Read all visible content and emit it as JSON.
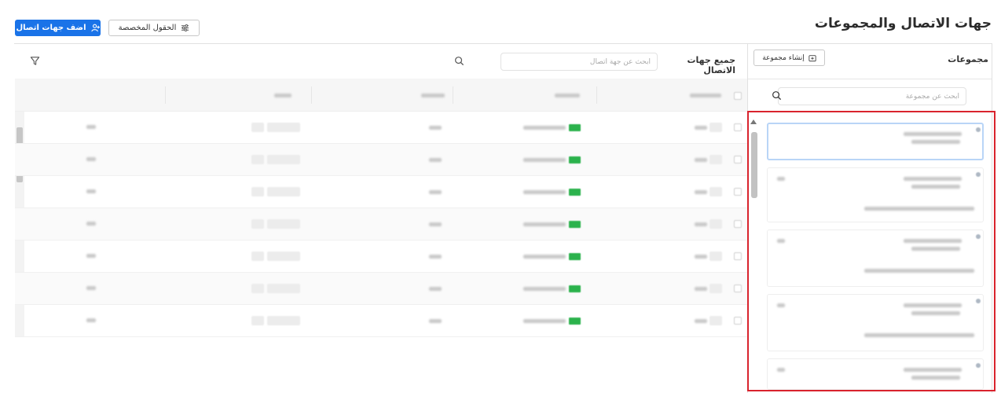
{
  "header": {
    "title": "جهات الاتصال والمجموعات",
    "add_contacts_label": "اضف جهات اتصال",
    "custom_fields_label": "الحقول المخصصة"
  },
  "groups_panel": {
    "title": "مجموعات",
    "create_group_label": "إنشاء مجموعة",
    "search_placeholder": "ابحث عن مجموعة"
  },
  "contacts_panel": {
    "title": "جميع جهات الاتصال",
    "search_placeholder": "ابحث عن جهة اتصال"
  },
  "colors": {
    "primary": "#1a73e8",
    "highlight_border": "#d9232d",
    "status_green": "#2bb24c",
    "selected_card_border": "#b9d5f7"
  },
  "icons": {
    "add_contacts": "add-user-icon",
    "custom_fields": "sliders-icon",
    "create_group": "folder-plus-icon",
    "search": "search-icon",
    "filter": "filter-icon"
  }
}
